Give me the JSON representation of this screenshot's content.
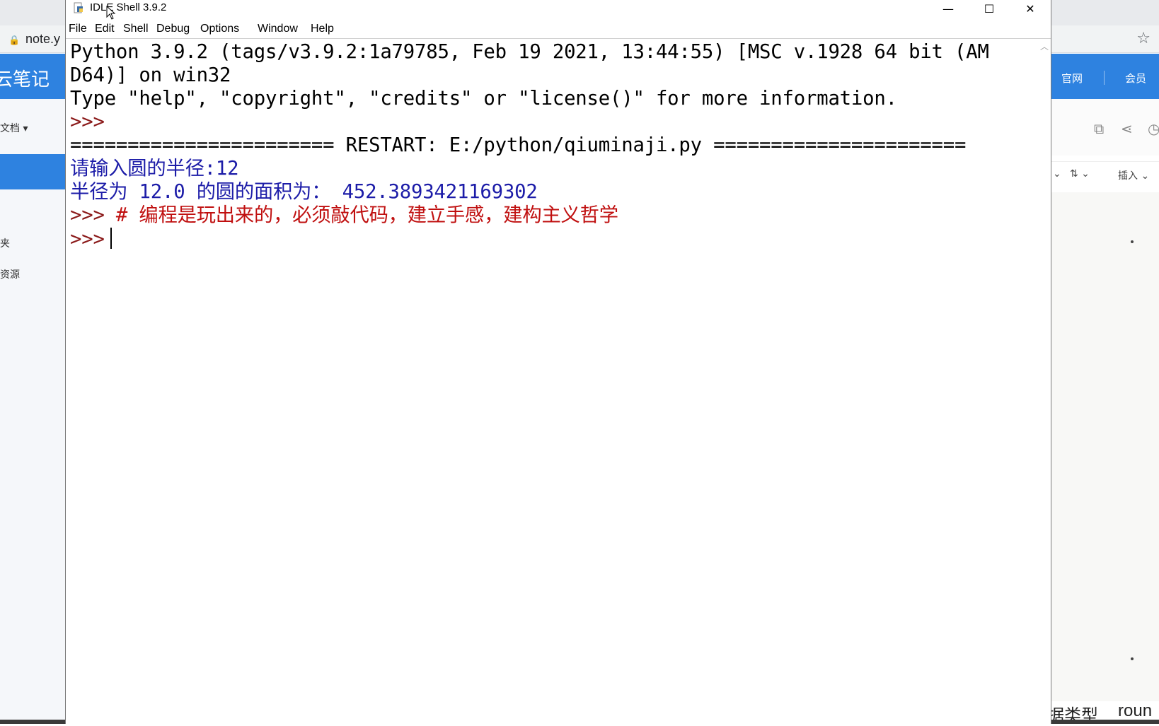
{
  "background_app": {
    "url": "note.y",
    "app_title": "云笔记",
    "links": {
      "official": "官网",
      "member": "会员"
    },
    "sidebar": {
      "docs": "文档 ▾",
      "folder": "夹",
      "resource": "资源"
    },
    "format": {
      "chevron": "⌄",
      "spacing": "⇅ ⌄",
      "insert": "插入 ⌄"
    },
    "bottom_text": [
      "据类型",
      "roun"
    ]
  },
  "idle_window": {
    "title": "IDLE Shell 3.9.2",
    "controls": {
      "minimize": "—",
      "maximize": "☐",
      "close": "✕"
    },
    "menu": [
      "File",
      "Edit",
      "Shell",
      "Debug",
      "Options",
      "Window",
      "Help"
    ],
    "shell_lines": [
      {
        "text": "Python 3.9.2 (tags/v3.9.2:1a79785, Feb 19 2021, 13:44:55) [MSC v.1928 64 bit (AM",
        "style": "black"
      },
      {
        "text": "D64)] on win32",
        "style": "black"
      },
      {
        "text": "Type \"help\", \"copyright\", \"credits\" or \"license()\" for more information.",
        "style": "black"
      },
      {
        "text": ">>>",
        "style": "prompt"
      },
      {
        "text": "======================= RESTART: E:/python/qiuminaji.py ======================",
        "style": "black"
      },
      {
        "text": "请输入圆的半径:12",
        "style": "out"
      },
      {
        "text": "半径为 12.0 的圆的面积为： 452.3893421169302",
        "style": "out"
      },
      {
        "prompt": ">>>",
        "text": " # 编程是玩出来的，必须敲代码，建立手感，建构主义哲学",
        "style": "comment"
      },
      {
        "prompt": ">>>",
        "text": "",
        "style": "input"
      }
    ]
  }
}
